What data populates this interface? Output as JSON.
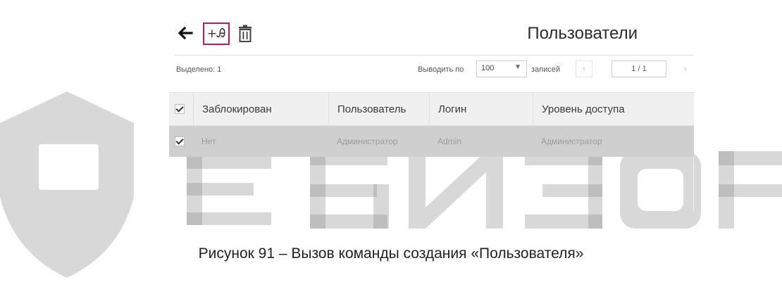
{
  "toolbar": {
    "title": "Пользователи",
    "icons": [
      "arrow-left-icon",
      "add-user-icon",
      "trash-icon"
    ],
    "add_user_glyph": "+Ꭿ",
    "highlight_color": "#c2185b"
  },
  "statusbar": {
    "selected": "Выделено: 1",
    "per_page_label": "Выводить по",
    "per_page_value": "100",
    "records_label": "записей",
    "prev": "‹",
    "page": "1 / 1",
    "next": "›"
  },
  "table": {
    "headers": [
      "Заблокирован",
      "Пользователь",
      "Логин",
      "Уровень доступа"
    ],
    "rows": [
      {
        "blocked": "Нет",
        "user": "Администратор",
        "login": "Admin",
        "access": "Администратор"
      }
    ]
  },
  "caption": "Рисунок 91 – Вызов команды создания «Пользователя»",
  "watermark": "РЕВИЗОР"
}
